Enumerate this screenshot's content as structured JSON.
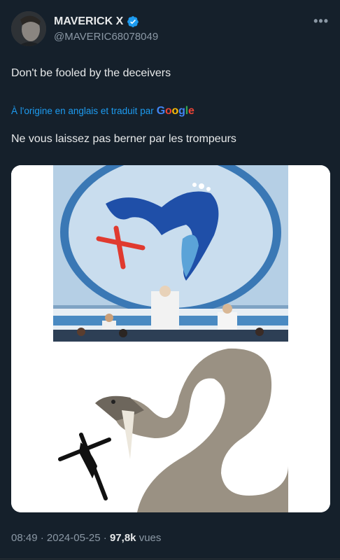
{
  "author": {
    "name": "MAVERICK X",
    "handle": "@MAVERIC68078049"
  },
  "more_label": "•••",
  "tweet": {
    "text": "Don't be fooled by the deceivers",
    "translation_note": "À l'origine en anglais et traduit par",
    "translation_provider": "Google",
    "translated_text": "Ne vous laissez pas berner par les trompeurs"
  },
  "media": {
    "icons": [
      "logo-icon",
      "cross-icon",
      "crucifix-icon",
      "snake-illustration"
    ]
  },
  "meta": {
    "time": "08:49",
    "separator": "·",
    "date": "2024-05-25",
    "views_count": "97,8k",
    "views_label": "vues"
  },
  "colors": {
    "background": "#15202b",
    "accent": "#1d9bf0",
    "secondary_text": "#8b98a5"
  }
}
